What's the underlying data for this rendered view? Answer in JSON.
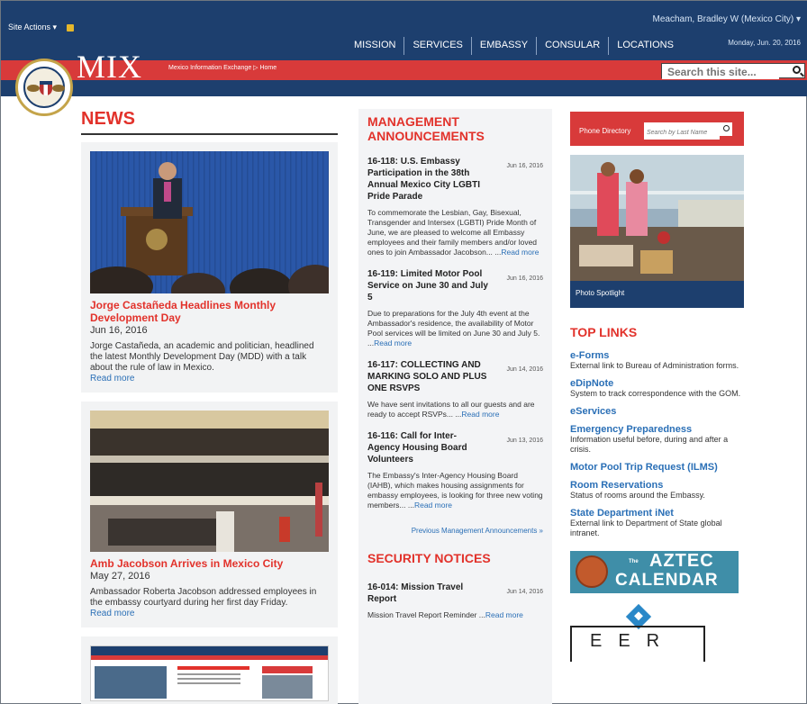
{
  "header": {
    "site_actions": "Site Actions ▾",
    "user": "Meacham, Bradley W (Mexico City) ▾",
    "date": "Monday, Jun. 20, 2016",
    "logo": "MIX",
    "breadcrumb": "Mexico Information Exchange ▷ Home",
    "nav": [
      "MISSION",
      "SERVICES",
      "EMBASSY",
      "CONSULAR",
      "LOCATIONS"
    ],
    "search_placeholder": "Search this site..."
  },
  "news": {
    "heading": "NEWS",
    "items": [
      {
        "title": "Jorge Castañeda Headlines Monthly Development Day",
        "date": "Jun 16, 2016",
        "text": "Jorge Castañeda, an academic and politician, headlined the latest Monthly Development Day (MDD) with a talk about the rule of law in Mexico.",
        "read": "Read more"
      },
      {
        "title": "Amb Jacobson Arrives in Mexico City",
        "date": "May 27, 2016",
        "text": "Ambassador Roberta Jacobson addressed employees in the embassy courtyard during her first day Friday.",
        "read": "Read more"
      }
    ]
  },
  "management": {
    "heading": "MANAGEMENT ANNOUNCEMENTS",
    "items": [
      {
        "title": "16-118: U.S. Embassy Participation in the 38th Annual Mexico City LGBTI Pride Parade",
        "date": "Jun 16, 2016",
        "text": "To commemorate the Lesbian, Gay, Bisexual, Transgender and Intersex (LGBTI) Pride Month of June, we are pleased to welcome all Embassy employees and their family members and/or loved ones to join Ambassador Jacobson... ...",
        "read": "Read more"
      },
      {
        "title": "16-119: Limited Motor Pool Service on June 30 and July 5",
        "date": "Jun 16, 2016",
        "text": "Due to preparations for the July 4th event at the Ambassador's residence, the availability of Motor Pool services will be limited on June 30 and July 5. ...",
        "read": "Read more"
      },
      {
        "title": "16-117: COLLECTING AND MARKING SOLO AND PLUS ONE RSVPS",
        "date": "Jun 14, 2016",
        "text": "We have sent invitations to all our guests and are ready to accept RSVPs... ...",
        "read": "Read more"
      },
      {
        "title": "16-116: Call for Inter-Agency Housing Board Volunteers",
        "date": "Jun 13, 2016",
        "text": "The Embassy's Inter-Agency Housing Board (IAHB), which makes housing assignments for embassy employees, is looking for three new voting members... ...",
        "read": "Read more"
      }
    ],
    "previous": "Previous Management Announcements »"
  },
  "security": {
    "heading": "SECURITY NOTICES",
    "items": [
      {
        "title": "16-014: Mission Travel Report",
        "date": "Jun 14, 2016",
        "text": "Mission Travel Report Reminder ...",
        "read": "Read more"
      }
    ]
  },
  "sidebar": {
    "phone_label": "Phone Directory",
    "phone_placeholder": "Search by Last Name",
    "photo_caption": "Photo Spotlight",
    "toplinks_heading": "TOP LINKS",
    "links": [
      {
        "title": "e-Forms",
        "desc": "External link to Bureau of Administration forms."
      },
      {
        "title": "eDipNote",
        "desc": "System to track correspondence with the GOM."
      },
      {
        "title": "eServices",
        "desc": ""
      },
      {
        "title": "Emergency Preparedness",
        "desc": "Information useful before, during and after a crisis."
      },
      {
        "title": "Motor Pool Trip Request (ILMS)",
        "desc": ""
      },
      {
        "title": "Room Reservations",
        "desc": "Status of rooms around the Embassy."
      },
      {
        "title": "State Department iNet",
        "desc": "External link to Department of State global intranet."
      }
    ],
    "aztec_the": "The",
    "aztec_line1": "AZTEC",
    "aztec_line2": "CALENDAR",
    "eer_letters": "EER"
  }
}
